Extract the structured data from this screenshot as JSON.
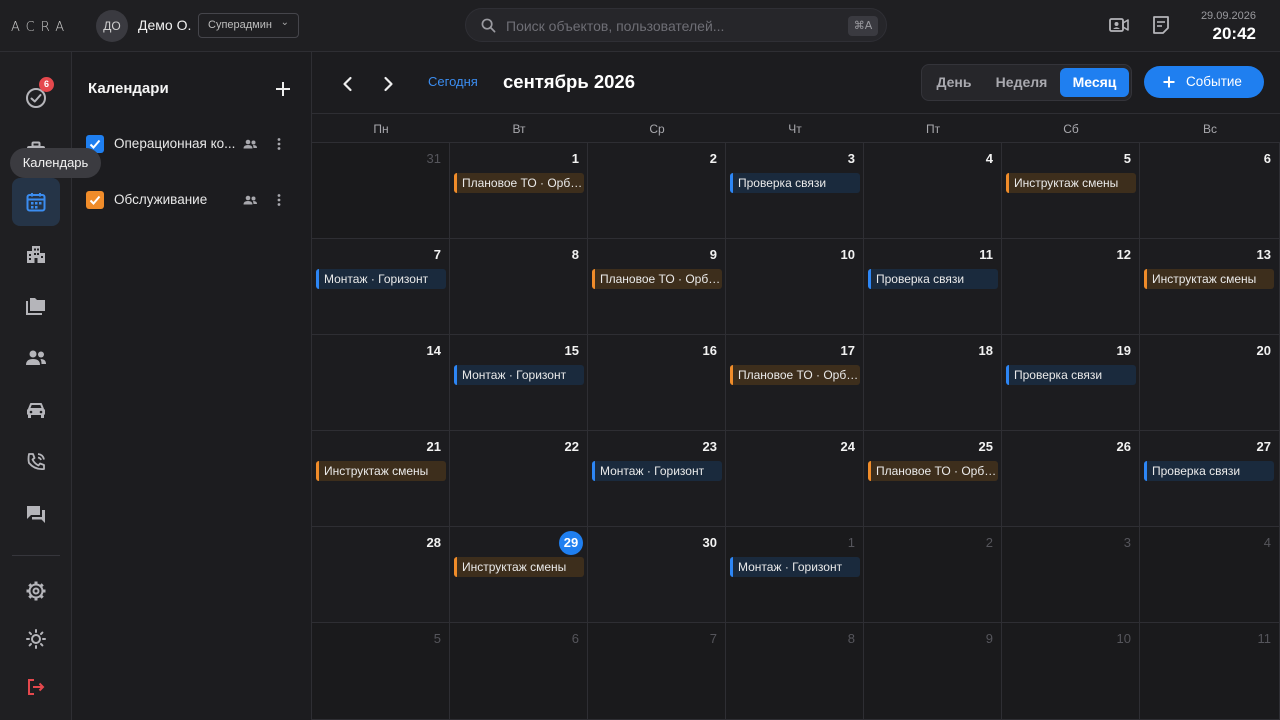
{
  "app": {
    "logo": "ACRA"
  },
  "user": {
    "initials": "ДО",
    "name": "Демо О.",
    "role": "Суперадмин"
  },
  "search": {
    "placeholder": "Поиск объектов, пользователей...",
    "shortcut": "⌘A"
  },
  "clock": {
    "date": "29.09.2026",
    "time": "20:42"
  },
  "rail": {
    "tasks_badge": "6",
    "tooltip": "Календарь"
  },
  "calendars": {
    "title": "Календари",
    "items": [
      {
        "name": "Операционная ко...",
        "color": "#1f7ff0"
      },
      {
        "name": "Обслуживание",
        "color": "#f08c2a"
      }
    ]
  },
  "toolbar": {
    "today": "Сегодня",
    "month_title": "сентябрь 2026",
    "views": [
      "День",
      "Неделя",
      "Месяц"
    ],
    "active_view": "Месяц",
    "event_button": "Событие"
  },
  "weekdays": [
    "Пн",
    "Вт",
    "Ср",
    "Чт",
    "Пт",
    "Сб",
    "Вс"
  ],
  "today_day": 29,
  "weeks": [
    [
      {
        "d": "31",
        "other": true
      },
      {
        "d": "1",
        "ev": {
          "t": "Плановое ТО · Орбита",
          "c": "orange"
        }
      },
      {
        "d": "2"
      },
      {
        "d": "3",
        "ev": {
          "t": "Проверка связи",
          "c": "blue"
        }
      },
      {
        "d": "4"
      },
      {
        "d": "5",
        "ev": {
          "t": "Инструктаж смены",
          "c": "orange"
        }
      },
      {
        "d": "6"
      }
    ],
    [
      {
        "d": "7",
        "ev": {
          "t": "Монтаж · Горизонт",
          "c": "blue"
        }
      },
      {
        "d": "8"
      },
      {
        "d": "9",
        "ev": {
          "t": "Плановое ТО · Орбита",
          "c": "orange"
        }
      },
      {
        "d": "10"
      },
      {
        "d": "11",
        "ev": {
          "t": "Проверка связи",
          "c": "blue"
        }
      },
      {
        "d": "12"
      },
      {
        "d": "13",
        "ev": {
          "t": "Инструктаж смены",
          "c": "orange"
        }
      }
    ],
    [
      {
        "d": "14"
      },
      {
        "d": "15",
        "ev": {
          "t": "Монтаж · Горизонт",
          "c": "blue"
        }
      },
      {
        "d": "16"
      },
      {
        "d": "17",
        "ev": {
          "t": "Плановое ТО · Орбита",
          "c": "orange"
        }
      },
      {
        "d": "18"
      },
      {
        "d": "19",
        "ev": {
          "t": "Проверка связи",
          "c": "blue"
        }
      },
      {
        "d": "20"
      }
    ],
    [
      {
        "d": "21",
        "ev": {
          "t": "Инструктаж смены",
          "c": "orange"
        }
      },
      {
        "d": "22"
      },
      {
        "d": "23",
        "ev": {
          "t": "Монтаж · Горизонт",
          "c": "blue"
        }
      },
      {
        "d": "24"
      },
      {
        "d": "25",
        "ev": {
          "t": "Плановое ТО · Орбита",
          "c": "orange"
        }
      },
      {
        "d": "26"
      },
      {
        "d": "27",
        "ev": {
          "t": "Проверка связи",
          "c": "blue"
        }
      }
    ],
    [
      {
        "d": "28"
      },
      {
        "d": "29",
        "today": true,
        "ev": {
          "t": "Инструктаж смены",
          "c": "orange"
        }
      },
      {
        "d": "30"
      },
      {
        "d": "1",
        "other": true,
        "ev": {
          "t": "Монтаж · Горизонт",
          "c": "blue"
        }
      },
      {
        "d": "2",
        "other": true
      },
      {
        "d": "3",
        "other": true
      },
      {
        "d": "4",
        "other": true
      }
    ],
    [
      {
        "d": "5",
        "other": true
      },
      {
        "d": "6",
        "other": true
      },
      {
        "d": "7",
        "other": true
      },
      {
        "d": "8",
        "other": true
      },
      {
        "d": "9",
        "other": true
      },
      {
        "d": "10",
        "other": true
      },
      {
        "d": "11",
        "other": true
      }
    ]
  ]
}
